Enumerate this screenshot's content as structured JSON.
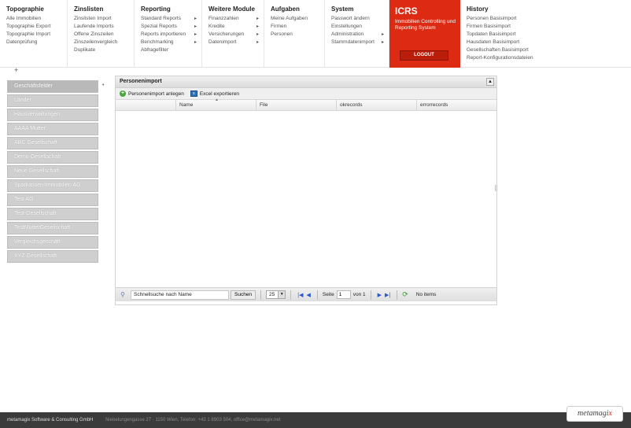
{
  "menu": [
    {
      "title": "Topographie",
      "items": [
        {
          "label": "Alle Immobilien",
          "arrow": false
        },
        {
          "label": "Topographie Export",
          "arrow": false
        },
        {
          "label": "Topographie Import",
          "arrow": false
        },
        {
          "label": "Datenprüfung",
          "arrow": false
        }
      ]
    },
    {
      "title": "Zinslisten",
      "items": [
        {
          "label": "Zinslisten Import",
          "arrow": false
        },
        {
          "label": "Laufende Imports",
          "arrow": false
        },
        {
          "label": "Offene Zinszeilen",
          "arrow": false
        },
        {
          "label": "Zinszeilenvergleich",
          "arrow": false
        },
        {
          "label": "Duplikate",
          "arrow": false
        }
      ]
    },
    {
      "title": "Reporting",
      "items": [
        {
          "label": "Standard Reports",
          "arrow": true
        },
        {
          "label": "Spezial Reports",
          "arrow": true
        },
        {
          "label": "Reports importieren",
          "arrow": true
        },
        {
          "label": "Benchmarking",
          "arrow": true
        },
        {
          "label": "Abfragefilter",
          "arrow": false
        }
      ]
    },
    {
      "title": "Weitere Module",
      "items": [
        {
          "label": "Finanzzahlen",
          "arrow": true
        },
        {
          "label": "Kredite",
          "arrow": true
        },
        {
          "label": "Versicherungen",
          "arrow": true
        },
        {
          "label": "Datenimport",
          "arrow": true
        }
      ]
    },
    {
      "title": "Aufgaben",
      "items": [
        {
          "label": "Meine Aufgaben",
          "arrow": false
        },
        {
          "label": "Firmen",
          "arrow": false
        },
        {
          "label": "Personen",
          "arrow": false
        }
      ]
    },
    {
      "title": "System",
      "items": [
        {
          "label": "Passwort ändern",
          "arrow": false
        },
        {
          "label": "Einstellungen",
          "arrow": false
        },
        {
          "label": "Administration",
          "arrow": true
        },
        {
          "label": "Stammdatenimport",
          "arrow": true
        }
      ]
    }
  ],
  "icrs": {
    "title": "ICRS",
    "subtitle": "Immobilien Controlling und Reporting System",
    "logout": "LOGOUT"
  },
  "history": {
    "title": "History",
    "items": [
      "Personen Basisimport",
      "Firmen Basisimport",
      "Topdaten Basisimport",
      "Hausdaten Basisimport",
      "Gesellschaften Basisimport",
      "Report-Konfigurationsdateien"
    ]
  },
  "sidebar": {
    "items": [
      "Geschäftsfelder",
      "Länder",
      "Hausverwaltungen",
      "AAAA Mutter",
      "ABC Gesellschaft",
      "Demo Gesellschaft",
      "Neue Gesellschaft",
      "Sparkassen Immobilien AG",
      "Test AG",
      "Test-Gesellschaft",
      "TestMutterGesellschaft",
      "Vergleichsgeschäft",
      "XYZ Gesellschaft"
    ]
  },
  "panel": {
    "title": "Personenimport",
    "toolbar": {
      "add": "Personenimport anlegen",
      "export": "Excel exportieren"
    },
    "columns": [
      "Name",
      "File",
      "okrecords",
      "errorrecords"
    ]
  },
  "pager": {
    "search_value": "Schnellsuche nach Name",
    "search_button": "Suchen",
    "page_size": "25",
    "page_label": "Seite",
    "page_value": "1",
    "of_label": "von 1",
    "status": "No items"
  },
  "footer": {
    "company": "metamagix Software & Consulting GmbH",
    "address": "Niebelungengasse 27 · 1150 Wien, Telefon: +43 1 8903 504, office@metamagix.net",
    "brand": "metamagi",
    "brand_x": "x"
  }
}
